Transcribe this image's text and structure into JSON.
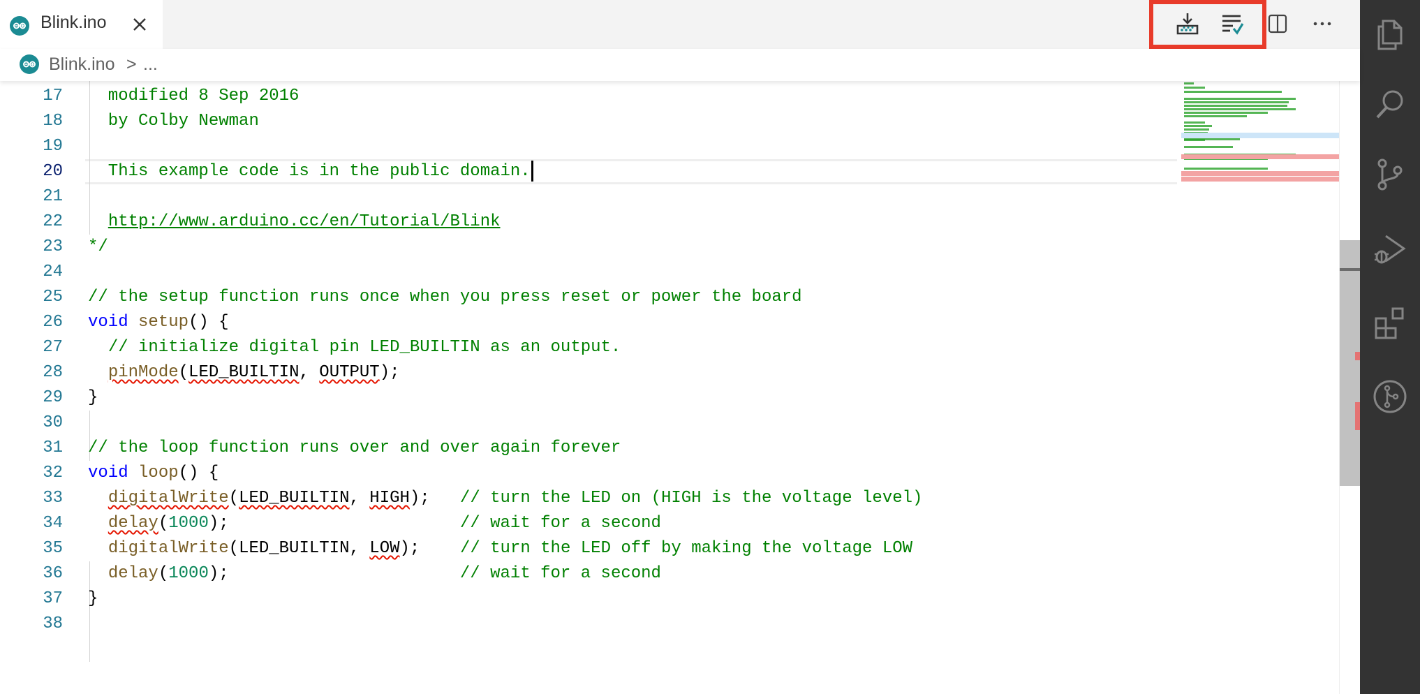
{
  "tab": {
    "filename": "Blink.ino"
  },
  "breadcrumb": {
    "file": "Blink.ino",
    "separator": ">",
    "more": "..."
  },
  "toolbar": {
    "upload_icon": "upload-icon",
    "verify_icon": "verify-icon",
    "split_icon": "split-editor-icon",
    "more_label": "···"
  },
  "editor": {
    "current_line": "20",
    "line_numbers": [
      "17",
      "18",
      "19",
      "20",
      "21",
      "22",
      "23",
      "24",
      "25",
      "26",
      "27",
      "28",
      "29",
      "30",
      "31",
      "32",
      "33",
      "34",
      "35",
      "36",
      "37",
      "38"
    ],
    "lines": {
      "l17": "  modified 8 Sep 2016",
      "l18": "  by Colby Newman",
      "l19": "",
      "l20": "  This example code is in the public domain.",
      "l21": "",
      "l22_link": "http://www.arduino.cc/en/Tutorial/Blink",
      "l23": "*/",
      "l24": "",
      "l25": "// the setup function runs once when you press reset or power the board",
      "l26_kw": "void",
      "l26_fn": "setup",
      "l26_rest": "() {",
      "l27": "// initialize digital pin LED_BUILTIN as an output.",
      "l28_fn": "pinMode",
      "l28_arg1": "LED_BUILTIN",
      "l28_arg2": "OUTPUT",
      "l29": "}",
      "l30": "",
      "l31": "// the loop function runs over and over again forever",
      "l32_kw": "void",
      "l32_fn": "loop",
      "l32_rest": "() {",
      "l33_fn": "digitalWrite",
      "l33_arg1": "LED_BUILTIN",
      "l33_arg2": "HIGH",
      "l33_comment": "// turn the LED on (HIGH is the voltage level)",
      "l34_fn": "delay",
      "l34_num": "1000",
      "l34_comment": "// wait for a second",
      "l35_fn": "digitalWrite",
      "l35_arg1": "LED_BUILTIN",
      "l35_arg2": "LOW",
      "l35_comment": "// turn the LED off by making the voltage LOW",
      "l36_fn": "delay",
      "l36_num": "1000",
      "l36_comment": "// wait for a second",
      "l37": "}",
      "l38": ""
    }
  },
  "activity_bar": {
    "items": [
      "explorer-icon",
      "search-icon",
      "source-control-icon",
      "run-debug-icon",
      "extensions-icon",
      "arduino-board-icon"
    ]
  },
  "colors": {
    "comment": "#008000",
    "keyword": "#0000ff",
    "function": "#795e26",
    "number": "#098658",
    "line_number": "#237893",
    "highlight_box": "#e83b2a",
    "activity_bar": "#333333"
  }
}
